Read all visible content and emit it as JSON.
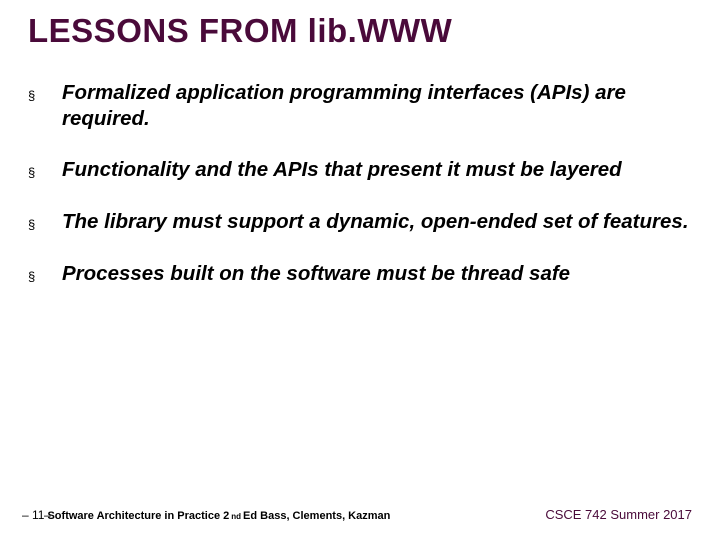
{
  "title": "LESSONS FROM lib.WWW",
  "bullets": [
    "Formalized application programming interfaces (APIs) are required.",
    "Functionality and the APIs that present it must be layered",
    "The library must support a dynamic, open-ended set of features.",
    "Processes built on the software must be thread safe"
  ],
  "footer": {
    "page_prefix": "– 11",
    "page_suffix": "–",
    "book_part1": "Software Architecture in Practice 2",
    "book_super": "nd",
    "book_part2": " Ed  Bass, Clements, Kazman",
    "course": "CSCE 742 Summer 2017"
  },
  "bullet_glyph": "§"
}
